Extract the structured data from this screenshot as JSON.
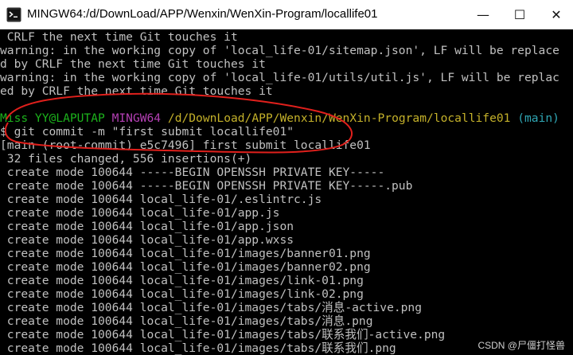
{
  "window": {
    "title": "MINGW64:/d/DownLoad/APP/Wenxin/WenXin-Program/locallife01",
    "icon": "git-bash-icon",
    "controls": {
      "minimize": "—",
      "maximize": "☐",
      "close": "✕"
    }
  },
  "terminal": {
    "lines": [
      " CRLF the next time Git touches it",
      "warning: in the working copy of 'local_life-01/sitemap.json', LF will be replace",
      "d by CRLF the next time Git touches it",
      "warning: in the working copy of 'local_life-01/utils/util.js', LF will be replac",
      "ed by CRLF the next time Git touches it",
      ""
    ],
    "prompt": {
      "user_host": "Miss YY@LAPUTAP",
      "system": "MINGW64",
      "path": "/d/DownLoad/APP/Wenxin/WenXin-Program/locallife01",
      "branch": "(main)"
    },
    "command": "$ git commit -m \"first submit locallife01\"",
    "output": [
      "[main (root-commit) e5c7496] first submit locallife01",
      " 32 files changed, 556 insertions(+)",
      " create mode 100644 -----BEGIN OPENSSH PRIVATE KEY-----",
      " create mode 100644 -----BEGIN OPENSSH PRIVATE KEY-----.pub",
      " create mode 100644 local_life-01/.eslintrc.js",
      " create mode 100644 local_life-01/app.js",
      " create mode 100644 local_life-01/app.json",
      " create mode 100644 local_life-01/app.wxss",
      " create mode 100644 local_life-01/images/banner01.png",
      " create mode 100644 local_life-01/images/banner02.png",
      " create mode 100644 local_life-01/images/link-01.png",
      " create mode 100644 local_life-01/images/link-02.png",
      " create mode 100644 local_life-01/images/tabs/消息-active.png",
      " create mode 100644 local_life-01/images/tabs/消息.png",
      " create mode 100644 local_life-01/images/tabs/联系我们-active.png",
      " create mode 100644 local_life-01/images/tabs/联系我们.png"
    ]
  },
  "watermark": "CSDN @尸僵打怪兽",
  "colors": {
    "background": "#000000",
    "text": "#c0c0c0",
    "user": "#1cb31c",
    "system": "#b540b5",
    "path": "#c4b12a",
    "branch": "#2fa6b4",
    "annotation": "#e0201c"
  }
}
